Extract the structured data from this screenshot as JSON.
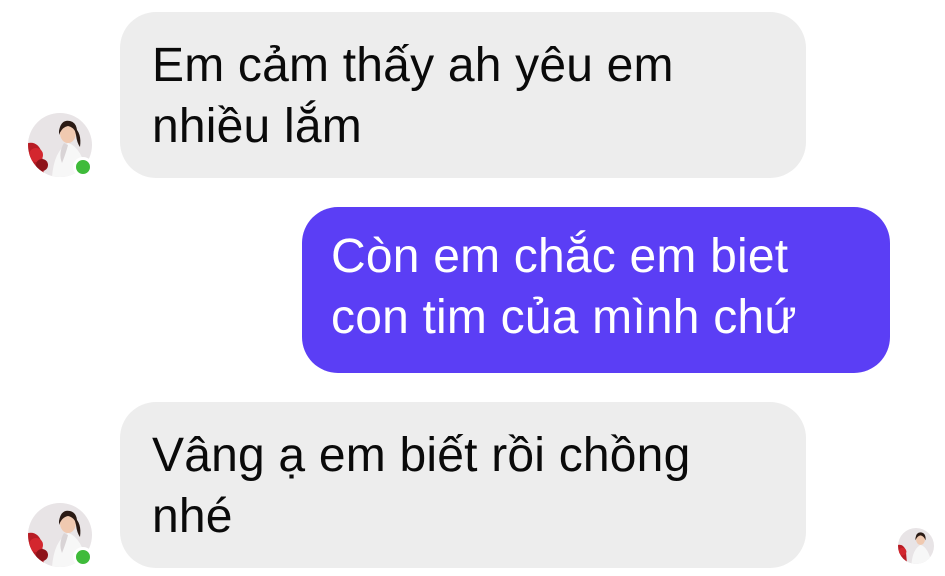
{
  "colors": {
    "incoming_bubble": "#ededed",
    "outgoing_bubble": "#5b3ef5",
    "online_indicator": "#3fbb3a",
    "text_dark": "#0a0a0a",
    "text_light": "#ffffff"
  },
  "messages": [
    {
      "direction": "incoming",
      "text": "Em cảm thấy ah yêu em\nnhiều lắm"
    },
    {
      "direction": "outgoing",
      "text": "Còn em chắc em biet\ncon tim của mình chứ"
    },
    {
      "direction": "incoming",
      "text": "Vâng ạ em biết rồi chồng\nnhé"
    }
  ],
  "contact": {
    "avatar_icon": "contact-avatar-icon",
    "online": true
  },
  "read_receipt": {
    "icon": "seen-avatar-icon"
  }
}
